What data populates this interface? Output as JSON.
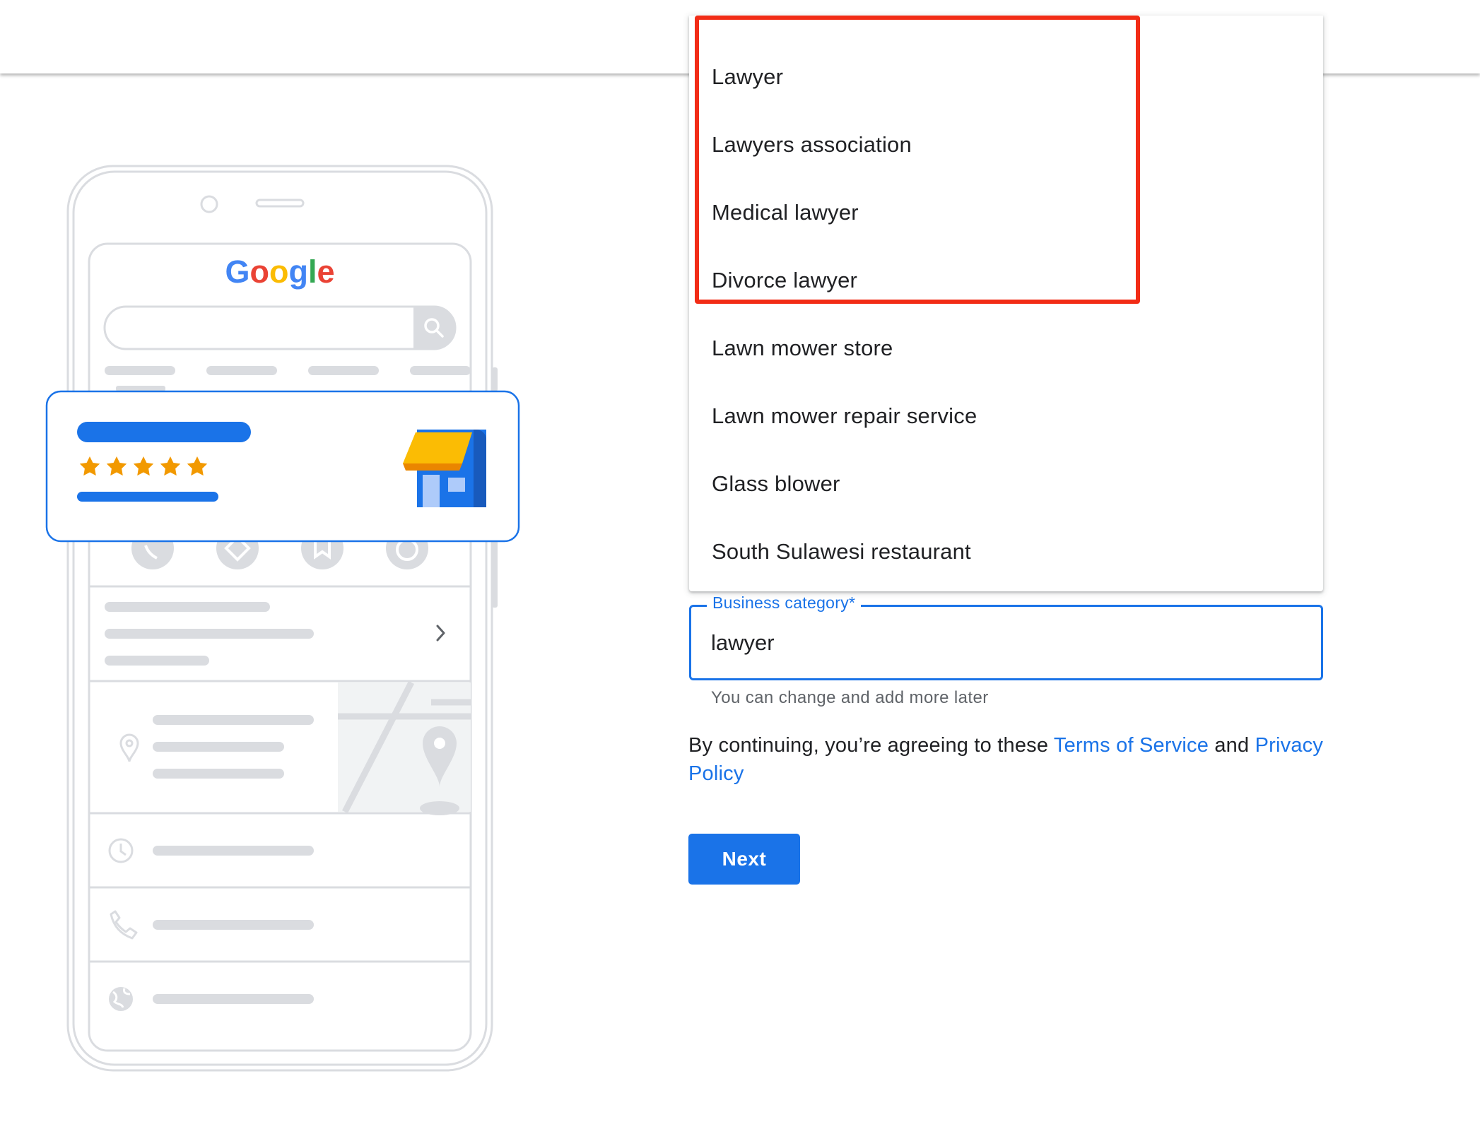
{
  "dropdown": {
    "items": [
      {
        "label": "Lawyer"
      },
      {
        "label": "Lawyers association"
      },
      {
        "label": "Medical lawyer"
      },
      {
        "label": "Divorce lawyer"
      },
      {
        "label": "Lawn mower store"
      },
      {
        "label": "Lawn mower repair service"
      },
      {
        "label": "Glass blower"
      },
      {
        "label": "South Sulawesi restaurant"
      }
    ]
  },
  "form": {
    "category_label": "Business category*",
    "category_value": "lawyer",
    "helper_text": "You can change and add more later",
    "terms_prefix": "By continuing, you’re agreeing to these ",
    "terms_link": "Terms of Service",
    "terms_and": " and ",
    "privacy_link": "Privacy Policy",
    "next_label": "Next"
  },
  "illustration": {
    "logo_text": "Google",
    "rating_stars": 5
  },
  "colors": {
    "accent_blue": "#1a73e8",
    "highlight_red": "#f22c16",
    "star_orange": "#f29900",
    "awning_yellow": "#fbbc04",
    "placeholder_gray": "#dadce0"
  },
  "icons": [
    "search-icon",
    "phone-icon",
    "directions-icon",
    "bookmark-icon",
    "globe-icon",
    "chevron-right-icon",
    "location-pin-icon",
    "clock-icon",
    "storefront-icon",
    "star-icon"
  ]
}
